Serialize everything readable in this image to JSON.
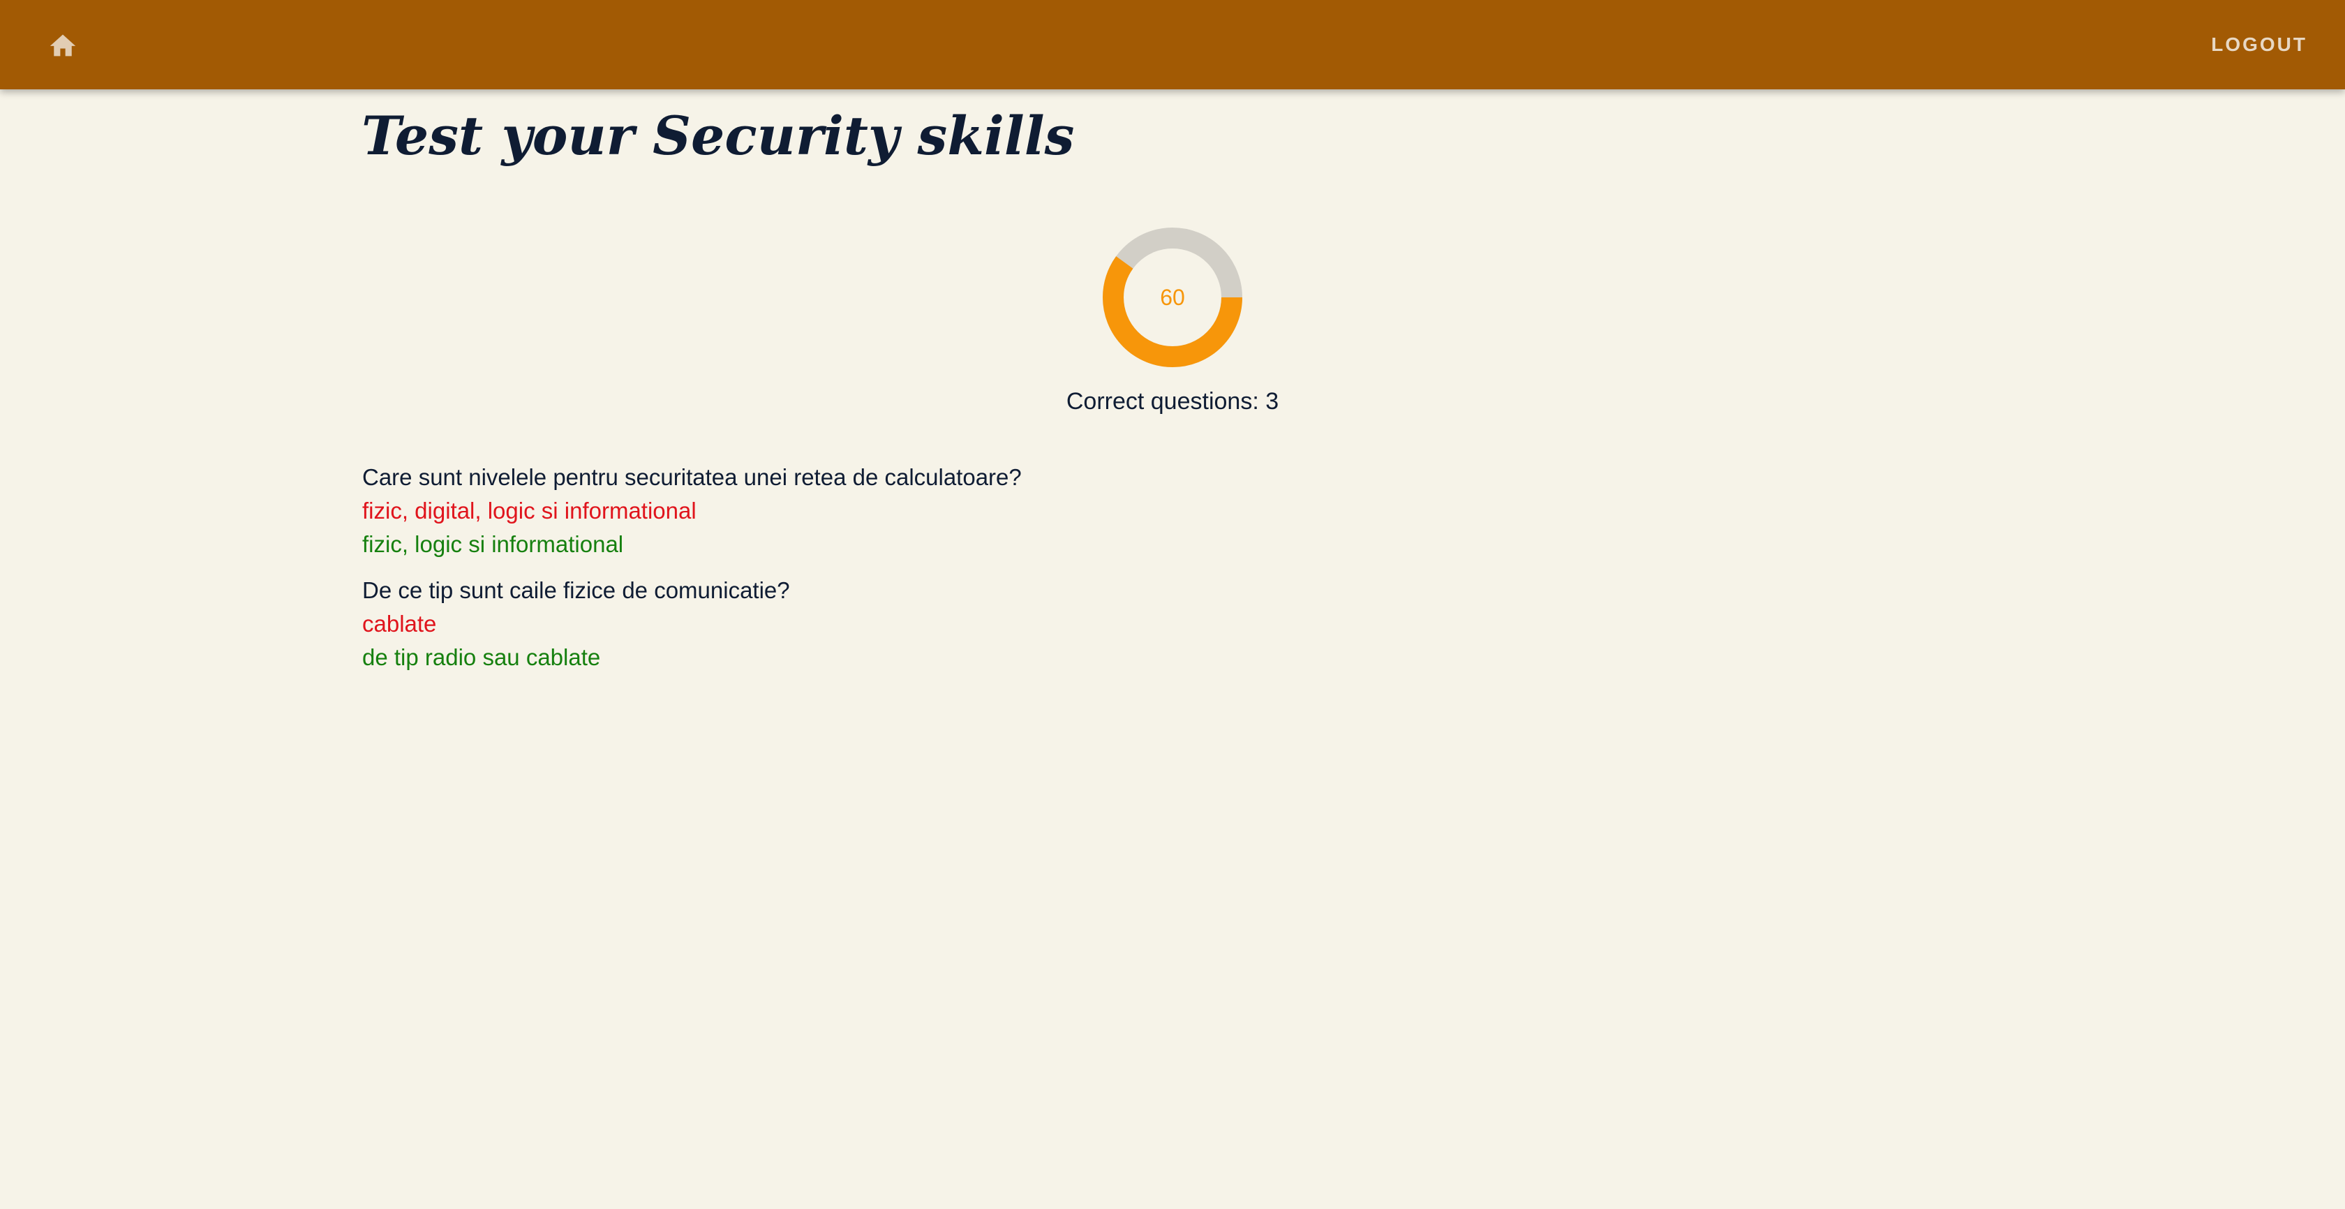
{
  "header": {
    "logout_label": "LOGOUT",
    "home_icon": "home-icon",
    "bar_color": "#a25a04"
  },
  "page": {
    "title": "Test your Security skills"
  },
  "score": {
    "value_label": "60",
    "percent": 60,
    "correct_label": "Correct questions: 3",
    "progress_color": "#f7960a",
    "track_color": "#d2cfc7"
  },
  "questions": [
    {
      "question": "Care sunt nivelele pentru securitatea unei retea de calculatoare?",
      "given_answer": "fizic, digital, logic si informational",
      "correct_answer": "fizic, logic si informational"
    },
    {
      "question": "De ce tip sunt caile fizice de comunicatie?",
      "given_answer": "cablate",
      "correct_answer": "de tip radio sau cablate"
    }
  ],
  "colors": {
    "wrong": "#e0141c",
    "right": "#16800f",
    "background": "#f6f3e8"
  }
}
